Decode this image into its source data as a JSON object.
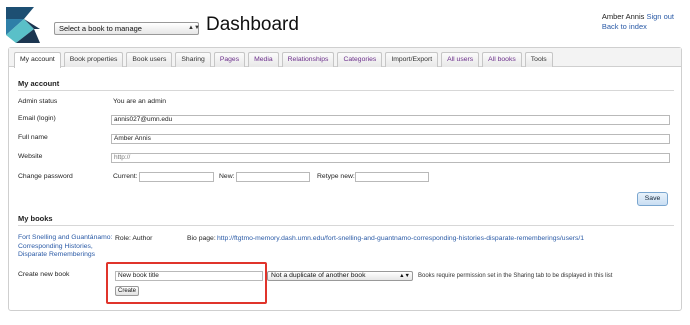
{
  "header": {
    "book_select_value": "Select a book to manage",
    "page_title": "Dashboard",
    "user_name": "Amber Annis",
    "sign_out_label": "Sign out",
    "back_to_index_label": "Back to index"
  },
  "tabs": [
    {
      "label": "My account",
      "active": true
    },
    {
      "label": "Book properties"
    },
    {
      "label": "Book users"
    },
    {
      "label": "Sharing"
    },
    {
      "label": "Pages"
    },
    {
      "label": "Media"
    },
    {
      "label": "Relationships"
    },
    {
      "label": "Categories"
    },
    {
      "label": "Import/Export"
    },
    {
      "label": "All users"
    },
    {
      "label": "All books"
    },
    {
      "label": "Tools"
    }
  ],
  "account": {
    "section_title": "My account",
    "admin_status_label": "Admin status",
    "admin_status_value": "You are an admin",
    "email_label": "Email (login)",
    "email_value": "annis027@umn.edu",
    "full_name_label": "Full name",
    "full_name_value": "Amber Annis",
    "website_label": "Website",
    "website_placeholder": "http://",
    "change_password_label": "Change password",
    "current_label": "Current:",
    "new_label": "New:",
    "retype_label": "Retype new:",
    "save_label": "Save"
  },
  "books": {
    "section_title": "My books",
    "book_link_line1": "Fort Snelling and Guantánamo:",
    "book_link_line2": "Corresponding Histories,",
    "book_link_line3": "Disparate Rememberings",
    "role": "Role: Author",
    "bio_label": "Bio page:",
    "bio_link": "http://ftgtmo-memory.dash.umn.edu/fort-snelling-and-guantnamo-corresponding-histories-disparate-rememberings/users/1",
    "create_label": "Create new book",
    "new_title_value": "New book title",
    "duplicate_value": "Not a duplicate of another book",
    "note": "Books require permission set in the Sharing tab to be displayed in this list",
    "create_button": "Create"
  }
}
